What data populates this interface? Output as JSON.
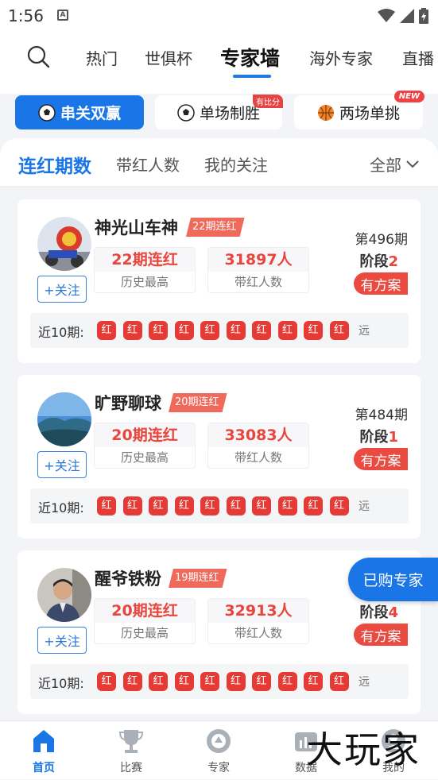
{
  "status_bar": {
    "time": "1:56",
    "app_icon_letter": "A"
  },
  "top_tabs": [
    {
      "label": "热门",
      "active": false
    },
    {
      "label": "世俱杯",
      "active": false
    },
    {
      "label": "专家墙",
      "active": true
    },
    {
      "label": "海外专家",
      "active": false
    },
    {
      "label": "直播",
      "active": false
    }
  ],
  "chips": [
    {
      "label": "串关双赢",
      "icon": "soccer-ball-icon",
      "active": true,
      "badge": ""
    },
    {
      "label": "单场制胜",
      "icon": "soccer-ball-icon",
      "active": false,
      "badge": "有比分"
    },
    {
      "label": "两场单挑",
      "icon": "basketball-icon",
      "active": false,
      "badge": "NEW"
    }
  ],
  "sub_tabs": [
    {
      "label": "连红期数",
      "active": true
    },
    {
      "label": "带红人数",
      "active": false
    },
    {
      "label": "我的关注",
      "active": false
    }
  ],
  "filter": {
    "label": "全部"
  },
  "experts": [
    {
      "name": "神光山车神",
      "streak_badge": "22期连红",
      "follow_label": "+关注",
      "stat1_value": "22期连红",
      "stat1_label": "历史最高",
      "stat2_value": "31897人",
      "stat2_label": "带红人数",
      "issue": "第496期",
      "stage_label": "阶段",
      "stage_num": "2",
      "plan_label": "有方案",
      "recent_label": "近10期:",
      "recent": [
        "红",
        "红",
        "红",
        "红",
        "红",
        "红",
        "红",
        "红",
        "红",
        "红"
      ],
      "far_label": "远"
    },
    {
      "name": "旷野聊球",
      "streak_badge": "20期连红",
      "follow_label": "+关注",
      "stat1_value": "20期连红",
      "stat1_label": "历史最高",
      "stat2_value": "33083人",
      "stat2_label": "带红人数",
      "issue": "第484期",
      "stage_label": "阶段",
      "stage_num": "1",
      "plan_label": "有方案",
      "recent_label": "近10期:",
      "recent": [
        "红",
        "红",
        "红",
        "红",
        "红",
        "红",
        "红",
        "红",
        "红",
        "红"
      ],
      "far_label": "远"
    },
    {
      "name": "醒爷铁粉",
      "streak_badge": "19期连红",
      "follow_label": "+关注",
      "stat1_value": "20期连红",
      "stat1_label": "历史最高",
      "stat2_value": "32913人",
      "stat2_label": "带红人数",
      "issue": "",
      "stage_label": "阶段",
      "stage_num": "4",
      "plan_label": "有方案",
      "recent_label": "近10期:",
      "recent": [
        "红",
        "红",
        "红",
        "红",
        "红",
        "红",
        "红",
        "红",
        "红",
        "红"
      ],
      "far_label": "远"
    }
  ],
  "float_button": {
    "label": "已购专家"
  },
  "bottom_nav": [
    {
      "label": "首页",
      "icon": "home-icon",
      "active": true
    },
    {
      "label": "比赛",
      "icon": "trophy-icon",
      "active": false
    },
    {
      "label": "专家",
      "icon": "expert-icon",
      "active": false
    },
    {
      "label": "数据",
      "icon": "data-icon",
      "active": false
    },
    {
      "label": "我的",
      "icon": "profile-icon",
      "active": false
    }
  ],
  "watermark": "大玩家"
}
